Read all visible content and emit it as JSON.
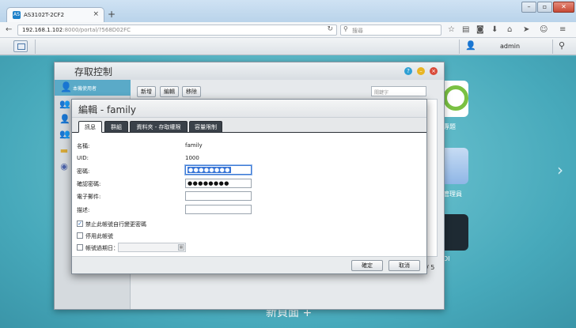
{
  "browser": {
    "tab_title": "AS3102T-2CF2",
    "url_host": "192.168.1.102",
    "url_rest": ":8000/portal/?568D02FC",
    "search_placeholder": "搜尋"
  },
  "adm": {
    "username": "admin"
  },
  "desktop": {
    "new_page_label": "新頁面 +",
    "tile_labels": [
      "專題",
      "管理員",
      "DI"
    ]
  },
  "access_window": {
    "title": "存取控制",
    "sidebar_active_label": "本機使用者",
    "toolbar": {
      "add": "新增",
      "edit": "編輯",
      "remove": "移除"
    },
    "search_placeholder": "關鍵字",
    "pager": "/ 5"
  },
  "dialog": {
    "title": "編輯 - family",
    "tabs": [
      "訊息",
      "群組",
      "資料夾 - 存取權限",
      "容量限制"
    ],
    "fields": {
      "name_label": "名稱:",
      "name_value": "family",
      "uid_label": "UID:",
      "uid_value": "1000",
      "password_label": "密碼:",
      "password_value": "●●●●●●●●",
      "confirm_label": "確認密碼:",
      "confirm_value": "●●●●●●●●",
      "email_label": "電子郵件:",
      "description_label": "描述:"
    },
    "checkboxes": {
      "prevent_change": "禁止此帳號自行變更密碼",
      "prevent_change_checked": true,
      "disable_account": "停用此帳號",
      "disable_account_checked": false,
      "expiry": "帳號過期日：",
      "expiry_checked": false
    },
    "buttons": {
      "ok": "確定",
      "cancel": "取消"
    }
  },
  "colors": {
    "desktop_teal": "#47a9bb",
    "sidebar_active": "#5aaac8",
    "tab_dark": "#3a4149"
  }
}
